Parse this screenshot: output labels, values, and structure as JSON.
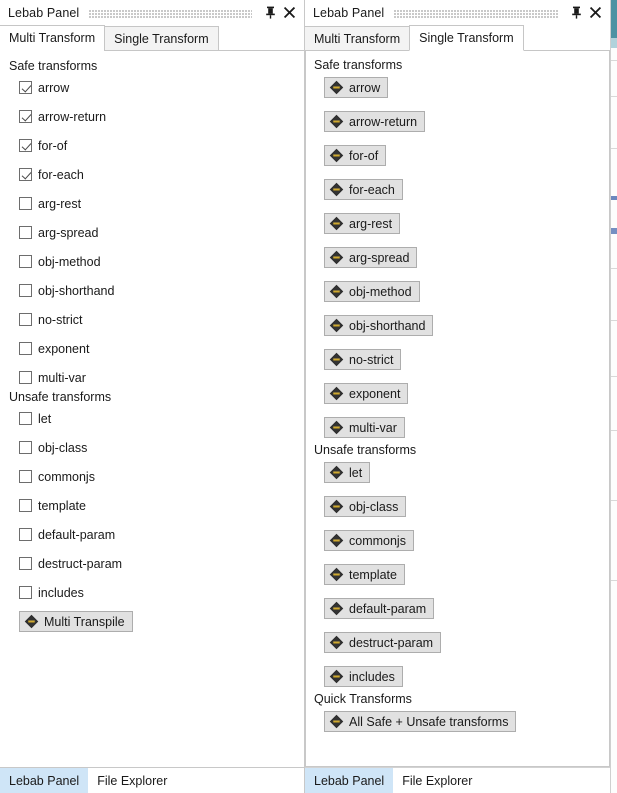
{
  "window": {
    "title": "Lebab Panel",
    "pin_icon": "pin-icon",
    "close_icon": "close-icon"
  },
  "tabs": {
    "multi": "Multi Transform",
    "single": "Single Transform"
  },
  "sections": {
    "safe": "Safe transforms",
    "unsafe": "Unsafe transforms",
    "quick": "Quick Transforms"
  },
  "multi_panel": {
    "active_tab": "Multi Transform",
    "safe_transforms": [
      {
        "label": "arrow",
        "checked": true
      },
      {
        "label": "arrow-return",
        "checked": true
      },
      {
        "label": "for-of",
        "checked": true
      },
      {
        "label": "for-each",
        "checked": true
      },
      {
        "label": "arg-rest",
        "checked": false
      },
      {
        "label": "arg-spread",
        "checked": false
      },
      {
        "label": "obj-method",
        "checked": false
      },
      {
        "label": "obj-shorthand",
        "checked": false
      },
      {
        "label": "no-strict",
        "checked": false
      },
      {
        "label": "exponent",
        "checked": false
      },
      {
        "label": "multi-var",
        "checked": false
      }
    ],
    "unsafe_transforms": [
      {
        "label": "let",
        "checked": false
      },
      {
        "label": "obj-class",
        "checked": false
      },
      {
        "label": "commonjs",
        "checked": false
      },
      {
        "label": "template",
        "checked": false
      },
      {
        "label": "default-param",
        "checked": false
      },
      {
        "label": "destruct-param",
        "checked": false
      },
      {
        "label": "includes",
        "checked": false
      }
    ],
    "action_button": "Multi Transpile"
  },
  "single_panel": {
    "active_tab": "Single Transform",
    "safe_transforms": [
      "arrow",
      "arrow-return",
      "for-of",
      "for-each",
      "arg-rest",
      "arg-spread",
      "obj-method",
      "obj-shorthand",
      "no-strict",
      "exponent",
      "multi-var"
    ],
    "unsafe_transforms": [
      "let",
      "obj-class",
      "commonjs",
      "template",
      "default-param",
      "destruct-param",
      "includes"
    ],
    "quick_transforms": [
      "All Safe + Unsafe transforms"
    ]
  },
  "bottom_tabs": [
    {
      "label": "Lebab Panel",
      "active": true
    },
    {
      "label": "File Explorer",
      "active": false
    }
  ],
  "colors": {
    "accent_tab_active": "#cfe5f7",
    "button_face": "#e1e1e1",
    "button_border": "#adadad",
    "panel_border": "#c8c8c8",
    "icon_dark": "#2b2b2b",
    "icon_gold": "#c9a227",
    "text": "#1a1a1a"
  }
}
